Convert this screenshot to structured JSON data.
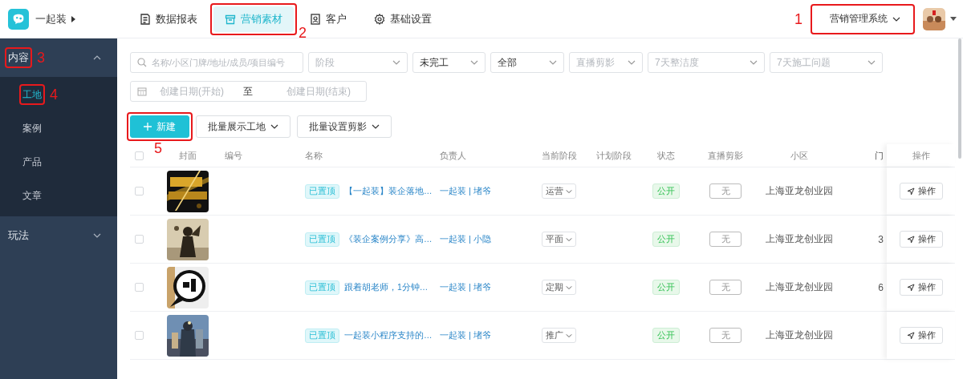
{
  "brand": {
    "name": "一起装"
  },
  "nav_tabs": [
    {
      "label": "数据报表",
      "kind": "report",
      "selected": false
    },
    {
      "label": "营销素材",
      "kind": "box",
      "selected": true,
      "annotation": "2"
    },
    {
      "label": "客户",
      "kind": "contact",
      "selected": false
    },
    {
      "label": "基础设置",
      "kind": "gear",
      "selected": false
    }
  ],
  "system_switcher": {
    "label": "营销管理系统",
    "annotation": "1"
  },
  "sidebar": {
    "groups": [
      {
        "label": "内容",
        "expanded": true,
        "annotation": "3",
        "children": [
          {
            "label": "工地",
            "selected": true,
            "annotation": "4"
          },
          {
            "label": "案例",
            "selected": false
          },
          {
            "label": "产品",
            "selected": false
          },
          {
            "label": "文章",
            "selected": false
          }
        ]
      },
      {
        "label": "玩法",
        "expanded": false
      }
    ]
  },
  "filters": {
    "search": {
      "placeholder": "名称/小区门牌/地址/成员/项目编号"
    },
    "selects": [
      {
        "placeholder": "阶段"
      },
      {
        "value": "未完工"
      },
      {
        "value": "全部"
      },
      {
        "placeholder": "直播剪影"
      },
      {
        "placeholder": "7天整洁度"
      },
      {
        "placeholder": "7天施工问题"
      }
    ],
    "date_range": {
      "start_placeholder": "创建日期(开始)",
      "separator": "至",
      "end_placeholder": "创建日期(结束)"
    }
  },
  "actions": [
    {
      "label": "新建",
      "kind": "primary",
      "annotation": "5"
    },
    {
      "label": "批量展示工地",
      "kind": "dropdown"
    },
    {
      "label": "批量设置剪影",
      "kind": "dropdown"
    }
  ],
  "table": {
    "select_all_checked": false,
    "columns": [
      "封面",
      "编号",
      "名称",
      "负责人",
      "当前阶段",
      "计划阶段",
      "状态",
      "直播剪影",
      "小区",
      "门",
      "操作"
    ],
    "rows": [
      {
        "checked": false,
        "tag": "已置顶",
        "name": "【一起装】装企落地…",
        "owner": "一起装 | 堵爷",
        "stage": "运营",
        "status": "公开",
        "clip": "无",
        "community": "上海亚龙创业园",
        "action": "操作"
      },
      {
        "checked": false,
        "tag": "已置顶",
        "name": "《装企案例分享》高…",
        "owner": "一起装 | 小隐",
        "stage": "平面",
        "status": "公开",
        "clip": "无",
        "community": "上海亚龙创业园",
        "column_10": "3",
        "action": "操作"
      },
      {
        "checked": false,
        "tag": "已置顶",
        "name": "跟着胡老师，1分钟…",
        "owner": "一起装 | 堵爷",
        "stage": "定期",
        "status": "公开",
        "clip": "无",
        "community": "上海亚龙创业园",
        "column_10": "6",
        "action": "操作"
      },
      {
        "checked": false,
        "tag": "已置顶",
        "name": "一起装小程序支持的…",
        "owner": "一起装 | 堵爷",
        "stage": "推广",
        "status": "公开",
        "clip": "无",
        "community": "上海亚龙创业园",
        "action": "操作"
      }
    ]
  }
}
